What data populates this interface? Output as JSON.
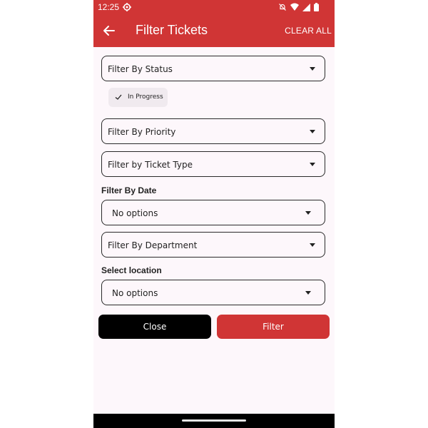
{
  "status_bar": {
    "time": "12:25"
  },
  "app_bar": {
    "title": "Filter Tickets",
    "clear_all": "CLEAR ALL"
  },
  "filters": {
    "status": {
      "label": "Filter By Status",
      "selected_chip": "In Progress"
    },
    "priority": {
      "label": "Filter By Priority"
    },
    "ticket_type": {
      "label": "Filter by Ticket Type"
    },
    "date": {
      "heading": "Filter By Date",
      "value": "No options"
    },
    "department": {
      "label": "Filter By Department"
    },
    "location": {
      "heading": "Select location",
      "value": "No options"
    }
  },
  "actions": {
    "close_label": "Close",
    "filter_label": "Filter"
  },
  "colors": {
    "primary": "#d03535",
    "background": "#fdf7fb",
    "close_button": "#000000",
    "chip_background": "#f0eaef"
  },
  "icons": {
    "back": "arrow-left-icon",
    "settings": "gear-icon",
    "dropdown": "caret-down-icon",
    "chip_check": "check-icon"
  }
}
